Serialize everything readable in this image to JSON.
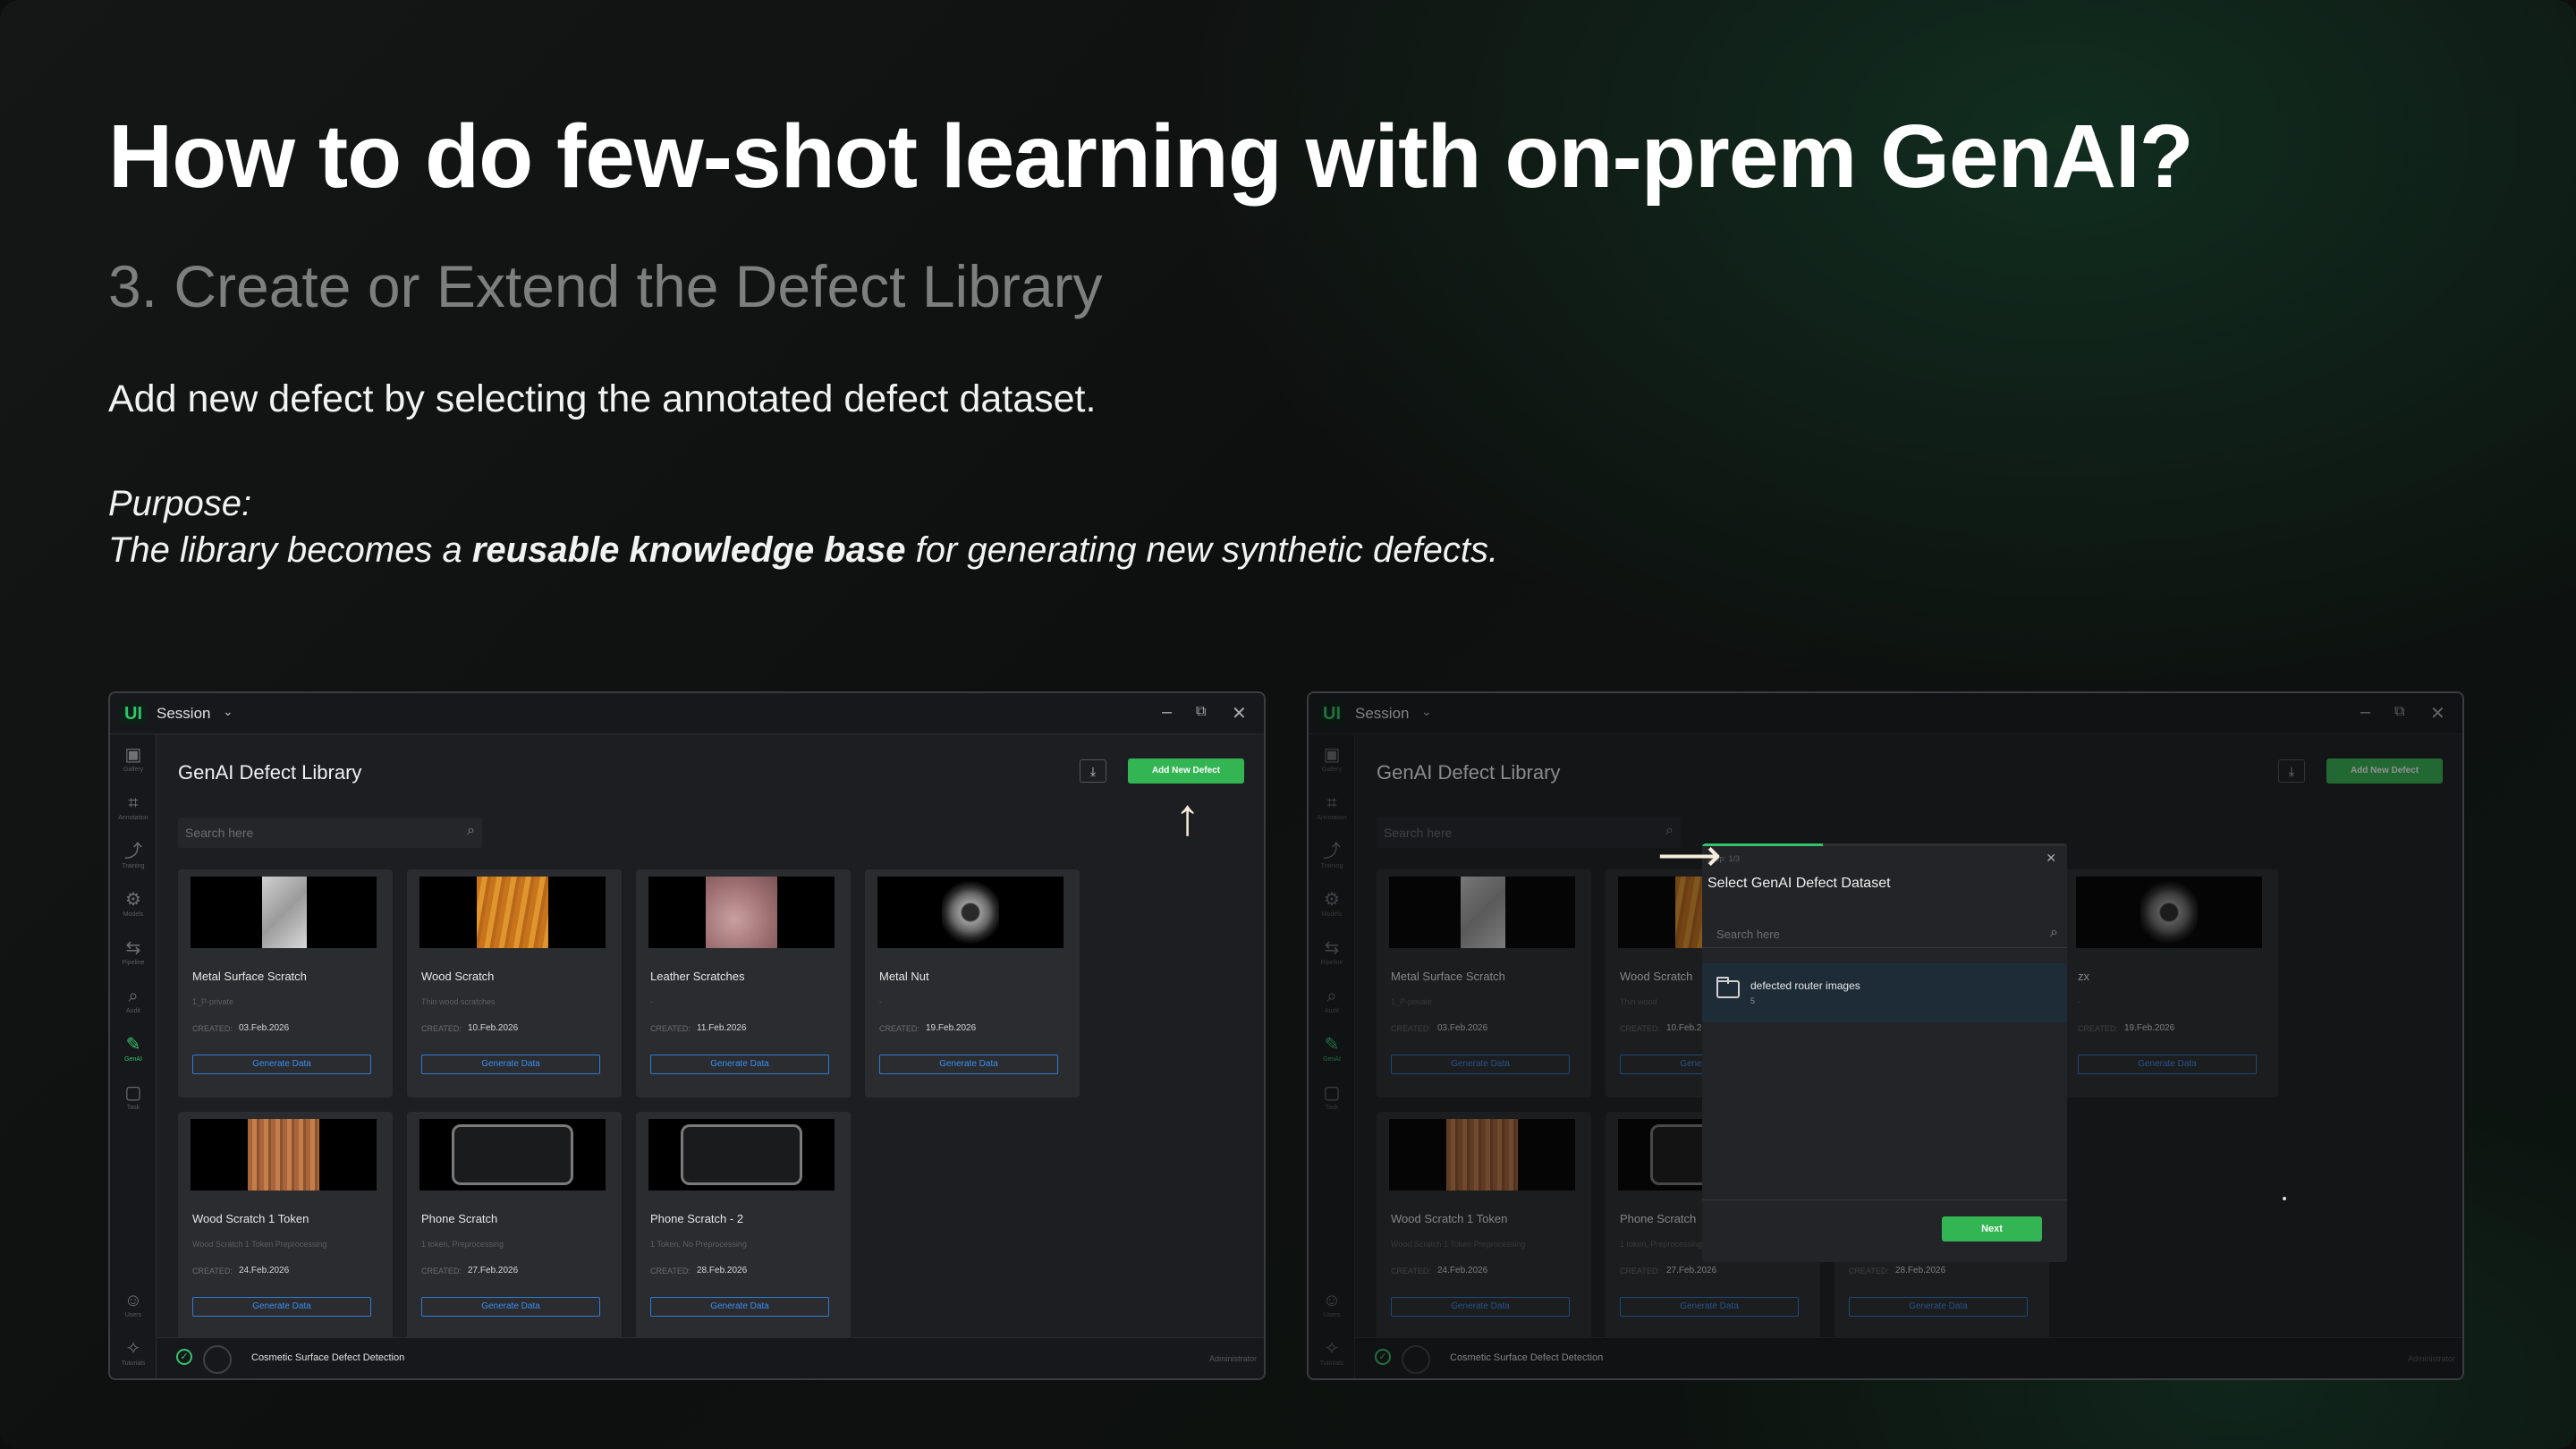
{
  "slide": {
    "title": "How to do few-shot learning with on-prem GenAI?",
    "subtitle": "3. Create or Extend the Defect Library",
    "description": "Add new defect by selecting the annotated defect dataset.",
    "purpose_label": "Purpose:",
    "purpose_pre": "The library becomes a ",
    "purpose_bold": "reusable knowledge base",
    "purpose_post": " for generating new synthetic defects."
  },
  "app": {
    "logo": "UI",
    "session_label": "Session",
    "page_title": "GenAI Defect Library",
    "add_button": "Add New Defect",
    "search_placeholder": "Search here",
    "created_label": "CREATED:",
    "generate_button": "Generate Data",
    "project_name": "Cosmetic Surface Defect Detection",
    "user_role": "Administrator",
    "sidebar": [
      {
        "icon": "gallery-icon",
        "label": "Gallery"
      },
      {
        "icon": "annotation-icon",
        "label": "Annotation"
      },
      {
        "icon": "training-icon",
        "label": "Training"
      },
      {
        "icon": "models-icon",
        "label": "Models"
      },
      {
        "icon": "pipeline-icon",
        "label": "Pipeline"
      },
      {
        "icon": "audit-icon",
        "label": "Audit"
      },
      {
        "icon": "genai-icon",
        "label": "GenAI"
      },
      {
        "icon": "task-icon",
        "label": "Task"
      }
    ],
    "sidebar_bottom": [
      {
        "icon": "user-icon",
        "label": "Users"
      },
      {
        "icon": "tutorial-icon",
        "label": "Tutorials"
      }
    ],
    "cards": [
      {
        "name": "Metal Surface Scratch",
        "desc": "1_P-private",
        "created": "03.Feb.2026"
      },
      {
        "name": "Wood Scratch",
        "desc": "Thin wood scratches",
        "created": "10.Feb.2026"
      },
      {
        "name": "Leather Scratches",
        "desc": "-",
        "created": "11.Feb.2026"
      },
      {
        "name": "Metal Nut",
        "desc": "-",
        "created": "19.Feb.2026"
      },
      {
        "name": "Wood Scratch 1 Token",
        "desc": "Wood Scratch 1 Token Preprocessing",
        "created": "24.Feb.2026"
      },
      {
        "name": "Phone Scratch",
        "desc": "1 token, Preprocessing",
        "created": "27.Feb.2026"
      },
      {
        "name": "Phone Scratch - 2",
        "desc": "1 Token, No Preprocessing",
        "created": "28.Feb.2026"
      }
    ],
    "right_cards": [
      {
        "name": "Metal Surface Scratch",
        "desc": "1_P-private",
        "created": "03.Feb.2026"
      },
      {
        "name": "Wood Scratch",
        "desc": "Thin wood",
        "created": "10.Feb.2026"
      },
      {
        "name": "zx",
        "desc": "-",
        "created": "19.Feb.2026"
      },
      {
        "name": "Wood Scratch 1 Token",
        "desc": "Wood Scratch 1 Token Preprocessing",
        "created": "24.Feb.2026"
      },
      {
        "name": "Phone Scratch",
        "desc": "1 token, Preprocessing",
        "created": "27.Feb.2026"
      },
      {
        "name": "",
        "desc": "",
        "created": "28.Feb.2026"
      }
    ]
  },
  "modal": {
    "step": "Step: 1/3",
    "progress": 0.33,
    "title": "Select GenAI Defect Dataset",
    "search_placeholder": "Search here",
    "item_name": "defected router images",
    "item_count": "5",
    "next_button": "Next"
  },
  "colors": {
    "accent_green": "#34b553",
    "link_blue": "#2d7dd2",
    "annotation_arrow": "#f6ecdb"
  }
}
